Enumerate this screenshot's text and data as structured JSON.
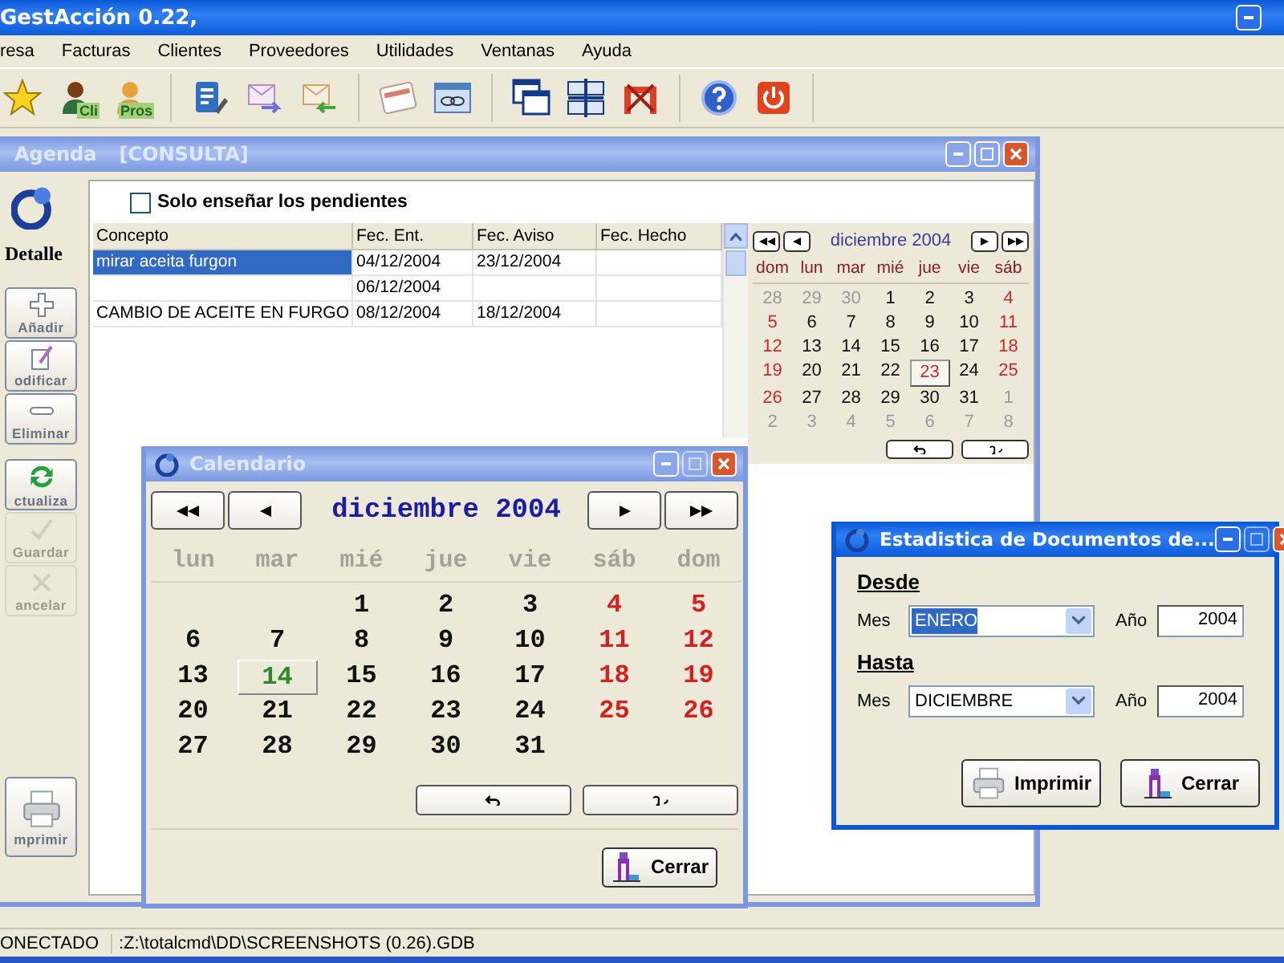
{
  "window": {
    "title": "GestAcción 0.22,"
  },
  "menu": [
    "resa",
    "Facturas",
    "Clientes",
    "Proveedores",
    "Utilidades",
    "Ventanas",
    "Ayuda"
  ],
  "toolbar": [
    [
      {
        "kind": "star"
      },
      {
        "kind": "client",
        "label": "Cli"
      },
      {
        "kind": "supplier",
        "label": "Pros"
      }
    ],
    [
      {
        "kind": "edit"
      },
      {
        "kind": "mail-out"
      },
      {
        "kind": "mail-in"
      }
    ],
    [
      {
        "kind": "calendar"
      },
      {
        "kind": "link"
      }
    ],
    [
      {
        "kind": "cascade"
      },
      {
        "kind": "tile"
      },
      {
        "kind": "close-all"
      }
    ],
    [
      {
        "kind": "help"
      },
      {
        "kind": "power"
      }
    ]
  ],
  "agenda": {
    "title": "Agenda",
    "mode": "[CONSULTA]",
    "active": false,
    "side_label": "Detalle",
    "side_buttons": [
      {
        "kind": "add",
        "label": "Añadir",
        "disabled": false
      },
      {
        "kind": "edit",
        "label": "odificar",
        "disabled": false
      },
      {
        "kind": "delete",
        "label": "Eliminar",
        "disabled": false
      },
      {
        "kind": "refresh",
        "label": "ctualiza",
        "disabled": false
      },
      {
        "kind": "save",
        "label": "Guardar",
        "disabled": true
      },
      {
        "kind": "cancel",
        "label": "ancelar",
        "disabled": true
      },
      {
        "kind": "print",
        "label": "mprimir",
        "disabled": false
      }
    ],
    "filter": {
      "label": "Solo enseñar los pendientes",
      "checked": false
    },
    "table": {
      "columns": [
        "Concepto",
        "Fec. Ent.",
        "Fec. Aviso",
        "Fec. Hecho"
      ],
      "rows": [
        {
          "cells": [
            "mirar aceita furgon",
            "04/12/2004",
            "23/12/2004",
            null
          ],
          "selected": true
        },
        {
          "cells": [
            null,
            "06/12/2004",
            null,
            null
          ],
          "selected": false
        },
        {
          "cells": [
            "CAMBIO DE ACEITE EN FURGO",
            "08/12/2004",
            "18/12/2004",
            null
          ],
          "selected": false
        }
      ]
    },
    "mini_calendar": {
      "month": "diciembre 2004",
      "weekdays": [
        "dom",
        "lun",
        "mar",
        "mié",
        "jue",
        "vie",
        "sáb"
      ],
      "days": [
        {
          "d": "28",
          "other": true,
          "weekend": false,
          "selected": false
        },
        {
          "d": "29",
          "other": true,
          "weekend": false,
          "selected": false
        },
        {
          "d": "30",
          "other": true,
          "weekend": false,
          "selected": false
        },
        {
          "d": "1",
          "other": false,
          "weekend": false,
          "selected": false
        },
        {
          "d": "2",
          "other": false,
          "weekend": false,
          "selected": false
        },
        {
          "d": "3",
          "other": false,
          "weekend": false,
          "selected": false
        },
        {
          "d": "4",
          "other": false,
          "weekend": true,
          "selected": false
        },
        {
          "d": "5",
          "other": false,
          "weekend": true,
          "selected": false
        },
        {
          "d": "6",
          "other": false,
          "weekend": false,
          "selected": false
        },
        {
          "d": "7",
          "other": false,
          "weekend": false,
          "selected": false
        },
        {
          "d": "8",
          "other": false,
          "weekend": false,
          "selected": false
        },
        {
          "d": "9",
          "other": false,
          "weekend": false,
          "selected": false
        },
        {
          "d": "10",
          "other": false,
          "weekend": false,
          "selected": false
        },
        {
          "d": "11",
          "other": false,
          "weekend": true,
          "selected": false
        },
        {
          "d": "12",
          "other": false,
          "weekend": true,
          "selected": false
        },
        {
          "d": "13",
          "other": false,
          "weekend": false,
          "selected": false
        },
        {
          "d": "14",
          "other": false,
          "weekend": false,
          "selected": false
        },
        {
          "d": "15",
          "other": false,
          "weekend": false,
          "selected": false
        },
        {
          "d": "16",
          "other": false,
          "weekend": false,
          "selected": false
        },
        {
          "d": "17",
          "other": false,
          "weekend": false,
          "selected": false
        },
        {
          "d": "18",
          "other": false,
          "weekend": true,
          "selected": false
        },
        {
          "d": "19",
          "other": false,
          "weekend": true,
          "selected": false
        },
        {
          "d": "20",
          "other": false,
          "weekend": false,
          "selected": false
        },
        {
          "d": "21",
          "other": false,
          "weekend": false,
          "selected": false
        },
        {
          "d": "22",
          "other": false,
          "weekend": false,
          "selected": false
        },
        {
          "d": "23",
          "other": false,
          "weekend": false,
          "selected": true
        },
        {
          "d": "24",
          "other": false,
          "weekend": false,
          "selected": false
        },
        {
          "d": "25",
          "other": false,
          "weekend": true,
          "selected": false
        },
        {
          "d": "26",
          "other": false,
          "weekend": true,
          "selected": false
        },
        {
          "d": "27",
          "other": false,
          "weekend": false,
          "selected": false
        },
        {
          "d": "28",
          "other": false,
          "weekend": false,
          "selected": false
        },
        {
          "d": "29",
          "other": false,
          "weekend": false,
          "selected": false
        },
        {
          "d": "30",
          "other": false,
          "weekend": false,
          "selected": false
        },
        {
          "d": "31",
          "other": false,
          "weekend": false,
          "selected": false
        },
        {
          "d": "1",
          "other": true,
          "weekend": false,
          "selected": false
        },
        {
          "d": "2",
          "other": true,
          "weekend": false,
          "selected": false
        },
        {
          "d": "3",
          "other": true,
          "weekend": false,
          "selected": false
        },
        {
          "d": "4",
          "other": true,
          "weekend": false,
          "selected": false
        },
        {
          "d": "5",
          "other": true,
          "weekend": false,
          "selected": false
        },
        {
          "d": "6",
          "other": true,
          "weekend": false,
          "selected": false
        },
        {
          "d": "7",
          "other": true,
          "weekend": false,
          "selected": false
        },
        {
          "d": "8",
          "other": true,
          "weekend": false,
          "selected": false
        }
      ]
    }
  },
  "calendario": {
    "title": "Calendario",
    "active": false,
    "month": "diciembre 2004",
    "weekdays": [
      "lun",
      "mar",
      "mié",
      "jue",
      "vie",
      "sáb",
      "dom"
    ],
    "weeks": [
      [
        {
          "d": "1",
          "weekend": false,
          "selected": false
        },
        {
          "d": "2",
          "weekend": false,
          "selected": false
        },
        {
          "d": "3",
          "weekend": false,
          "selected": false
        },
        {
          "d": "4",
          "weekend": true,
          "selected": false
        },
        {
          "d": "5",
          "weekend": true,
          "selected": false
        }
      ],
      [
        {
          "d": "6",
          "weekend": false,
          "selected": false
        },
        {
          "d": "7",
          "weekend": false,
          "selected": false
        },
        {
          "d": "8",
          "weekend": false,
          "selected": false
        },
        {
          "d": "9",
          "weekend": false,
          "selected": false
        },
        {
          "d": "10",
          "weekend": false,
          "selected": false
        },
        {
          "d": "11",
          "weekend": true,
          "selected": false
        },
        {
          "d": "12",
          "weekend": true,
          "selected": false
        }
      ],
      [
        {
          "d": "13",
          "weekend": false,
          "selected": false
        },
        {
          "d": "14",
          "weekend": false,
          "selected": true
        },
        {
          "d": "15",
          "weekend": false,
          "selected": false
        },
        {
          "d": "16",
          "weekend": false,
          "selected": false
        },
        {
          "d": "17",
          "weekend": false,
          "selected": false
        },
        {
          "d": "18",
          "weekend": true,
          "selected": false
        },
        {
          "d": "19",
          "weekend": true,
          "selected": false
        }
      ],
      [
        {
          "d": "20",
          "weekend": false,
          "selected": false
        },
        {
          "d": "21",
          "weekend": false,
          "selected": false
        },
        {
          "d": "22",
          "weekend": false,
          "selected": false
        },
        {
          "d": "23",
          "weekend": false,
          "selected": false
        },
        {
          "d": "24",
          "weekend": false,
          "selected": false
        },
        {
          "d": "25",
          "weekend": true,
          "selected": false
        },
        {
          "d": "26",
          "weekend": true,
          "selected": false
        }
      ],
      [
        {
          "d": "27",
          "weekend": false,
          "selected": false
        },
        {
          "d": "28",
          "weekend": false,
          "selected": false
        },
        {
          "d": "29",
          "weekend": false,
          "selected": false
        },
        {
          "d": "30",
          "weekend": false,
          "selected": false
        },
        {
          "d": "31",
          "weekend": false,
          "selected": false
        }
      ]
    ],
    "close_button": "Cerrar"
  },
  "estadistica": {
    "title": "Estadistica de Documentos de...",
    "active": true,
    "sections": [
      {
        "heading": "Desde",
        "month_label": "Mes",
        "month": "ENERO",
        "focused": true,
        "year_label": "Año",
        "year": "2004"
      },
      {
        "heading": "Hasta",
        "month_label": "Mes",
        "month": "DICIEMBRE",
        "focused": false,
        "year_label": "Año",
        "year": "2004"
      }
    ],
    "buttons": [
      {
        "kind": "print",
        "label": "Imprimir"
      },
      {
        "kind": "close",
        "label": "Cerrar"
      }
    ]
  },
  "status_bar": [
    "ONECTADO",
    ":Z:\\totalcmd\\DD\\SCREENSHOTS (0.26).GDB"
  ]
}
